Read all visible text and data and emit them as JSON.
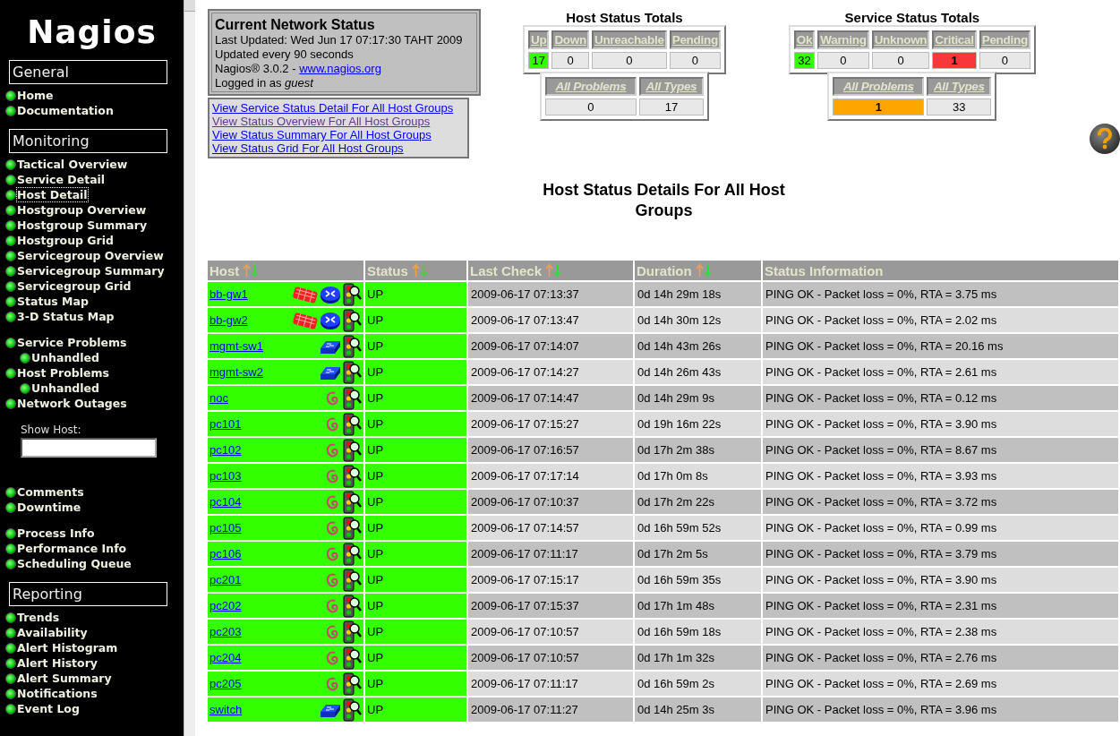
{
  "sidebar": {
    "logo": "Nagios",
    "sections": [
      {
        "title": "General",
        "groups": [
          {
            "kind": "links",
            "items": [
              {
                "label": "Home",
                "selected": false
              },
              {
                "label": "Documentation",
                "selected": false
              }
            ]
          }
        ]
      },
      {
        "title": "Monitoring",
        "groups": [
          {
            "kind": "links",
            "items": [
              {
                "label": "Tactical Overview",
                "selected": false
              },
              {
                "label": "Service Detail",
                "selected": false
              },
              {
                "label": "Host Detail",
                "selected": true
              },
              {
                "label": "Hostgroup Overview",
                "selected": false
              },
              {
                "label": "Hostgroup Summary",
                "selected": false
              },
              {
                "label": "Hostgroup Grid",
                "selected": false
              },
              {
                "label": "Servicegroup Overview",
                "selected": false
              },
              {
                "label": "Servicegroup Summary",
                "selected": false
              },
              {
                "label": "Servicegroup Grid",
                "selected": false
              },
              {
                "label": "Status Map",
                "selected": false
              },
              {
                "label": "3-D Status Map",
                "selected": false
              }
            ]
          },
          {
            "kind": "links",
            "items": [
              {
                "label": "Service Problems",
                "selected": false,
                "children": [
                  {
                    "label": "Unhandled",
                    "selected": false
                  }
                ]
              },
              {
                "label": "Host Problems",
                "selected": false,
                "children": [
                  {
                    "label": "Unhandled",
                    "selected": false
                  }
                ]
              },
              {
                "label": "Network Outages",
                "selected": false
              }
            ]
          },
          {
            "kind": "search",
            "label": "Show Host:"
          },
          {
            "kind": "links",
            "items": [
              {
                "label": "Comments",
                "selected": false
              },
              {
                "label": "Downtime",
                "selected": false
              }
            ]
          },
          {
            "kind": "links",
            "items": [
              {
                "label": "Process Info",
                "selected": false
              },
              {
                "label": "Performance Info",
                "selected": false
              },
              {
                "label": "Scheduling Queue",
                "selected": false
              }
            ]
          }
        ]
      },
      {
        "title": "Reporting",
        "groups": [
          {
            "kind": "links",
            "items": [
              {
                "label": "Trends",
                "selected": false
              },
              {
                "label": "Availability",
                "selected": false
              },
              {
                "label": "Alert Histogram",
                "selected": false
              },
              {
                "label": "Alert History",
                "selected": false
              },
              {
                "label": "Alert Summary",
                "selected": false
              },
              {
                "label": "Notifications",
                "selected": false
              },
              {
                "label": "Event Log",
                "selected": false
              }
            ]
          }
        ]
      }
    ]
  },
  "network_status": {
    "title": "Current Network Status",
    "last_updated": "Last Updated: Wed Jun 17 07:17:30 TAHT 2009",
    "interval": "Updated every 90 seconds",
    "version": "Nagios® 3.0.2 -",
    "website": "www.nagios.org",
    "login": "Logged in as *guest*"
  },
  "view_links": [
    {
      "label": "View Service Status Detail For All Host Groups",
      "visited": false
    },
    {
      "label": "View Status Overview For All Host Groups",
      "visited": true
    },
    {
      "label": "View Status Summary For All Host Groups",
      "visited": false
    },
    {
      "label": "View Status Grid For All Host Groups",
      "visited": false
    }
  ],
  "host_totals": {
    "title": "Host Status Totals",
    "cells": [
      {
        "label": "Up",
        "value": "17",
        "color": "#33ff00"
      },
      {
        "label": "Down",
        "value": "0"
      },
      {
        "label": "Unreachable",
        "value": "0"
      },
      {
        "label": "Pending",
        "value": "0"
      }
    ],
    "summary": [
      {
        "label": "All Problems",
        "value": "0"
      },
      {
        "label": "All Types",
        "value": "17"
      }
    ]
  },
  "service_totals": {
    "title": "Service Status Totals",
    "cells": [
      {
        "label": "Ok",
        "value": "32",
        "color": "#33ff00"
      },
      {
        "label": "Warning",
        "value": "0"
      },
      {
        "label": "Unknown",
        "value": "0"
      },
      {
        "label": "Critical",
        "value": "1",
        "color": "#f83838"
      },
      {
        "label": "Pending",
        "value": "0"
      }
    ],
    "summary": [
      {
        "label": "All Problems",
        "value": "1",
        "color": "#ffa500"
      },
      {
        "label": "All Types",
        "value": "33"
      }
    ]
  },
  "heading": "Host Status Details For All Host Groups",
  "table": {
    "columns": [
      {
        "label": "Host",
        "sortable": true
      },
      {
        "label": "Status",
        "sortable": true
      },
      {
        "label": "Last Check",
        "sortable": true
      },
      {
        "label": "Duration",
        "sortable": true
      },
      {
        "label": "Status Information",
        "sortable": false
      }
    ],
    "rows": [
      {
        "host": "bb-gw1",
        "kind": "router",
        "status": "UP",
        "last_check": "2009-06-17 07:13:37",
        "duration": "0d 14h 29m 18s",
        "info": "PING OK - Packet loss = 0%, RTA = 3.75 ms"
      },
      {
        "host": "bb-gw2",
        "kind": "router",
        "status": "UP",
        "last_check": "2009-06-17 07:13:47",
        "duration": "0d 14h 30m 12s",
        "info": "PING OK - Packet loss = 0%, RTA = 2.02 ms"
      },
      {
        "host": "mgmt-sw1",
        "kind": "switch",
        "status": "UP",
        "last_check": "2009-06-17 07:14:07",
        "duration": "0d 14h 43m 26s",
        "info": "PING OK - Packet loss = 0%, RTA = 20.16 ms"
      },
      {
        "host": "mgmt-sw2",
        "kind": "switch",
        "status": "UP",
        "last_check": "2009-06-17 07:14:27",
        "duration": "0d 14h 26m 43s",
        "info": "PING OK - Packet loss = 0%, RTA = 2.61 ms"
      },
      {
        "host": "noc",
        "kind": "debian",
        "status": "UP",
        "last_check": "2009-06-17 07:14:47",
        "duration": "0d 14h 29m 9s",
        "info": "PING OK - Packet loss = 0%, RTA = 0.12 ms"
      },
      {
        "host": "pc101",
        "kind": "debian",
        "status": "UP",
        "last_check": "2009-06-17 07:15:27",
        "duration": "0d 19h 16m 22s",
        "info": "PING OK - Packet loss = 0%, RTA = 3.90 ms"
      },
      {
        "host": "pc102",
        "kind": "debian",
        "status": "UP",
        "last_check": "2009-06-17 07:16:57",
        "duration": "0d 17h 2m 38s",
        "info": "PING OK - Packet loss = 0%, RTA = 8.67 ms"
      },
      {
        "host": "pc103",
        "kind": "debian",
        "status": "UP",
        "last_check": "2009-06-17 07:17:14",
        "duration": "0d 17h 0m 8s",
        "info": "PING OK - Packet loss = 0%, RTA = 3.93 ms"
      },
      {
        "host": "pc104",
        "kind": "debian",
        "status": "UP",
        "last_check": "2009-06-17 07:10:37",
        "duration": "0d 17h 2m 22s",
        "info": "PING OK - Packet loss = 0%, RTA = 3.72 ms"
      },
      {
        "host": "pc105",
        "kind": "debian",
        "status": "UP",
        "last_check": "2009-06-17 07:14:57",
        "duration": "0d 16h 59m 52s",
        "info": "PING OK - Packet loss = 0%, RTA = 0.99 ms"
      },
      {
        "host": "pc106",
        "kind": "debian",
        "status": "UP",
        "last_check": "2009-06-17 07:11:17",
        "duration": "0d 17h 2m 5s",
        "info": "PING OK - Packet loss = 0%, RTA = 3.79 ms"
      },
      {
        "host": "pc201",
        "kind": "debian",
        "status": "UP",
        "last_check": "2009-06-17 07:15:17",
        "duration": "0d 16h 59m 35s",
        "info": "PING OK - Packet loss = 0%, RTA = 3.90 ms"
      },
      {
        "host": "pc202",
        "kind": "debian",
        "status": "UP",
        "last_check": "2009-06-17 07:15:37",
        "duration": "0d 17h 1m 48s",
        "info": "PING OK - Packet loss = 0%, RTA = 2.31 ms"
      },
      {
        "host": "pc203",
        "kind": "debian",
        "status": "UP",
        "last_check": "2009-06-17 07:10:57",
        "duration": "0d 16h 59m 18s",
        "info": "PING OK - Packet loss = 0%, RTA = 2.38 ms"
      },
      {
        "host": "pc204",
        "kind": "debian",
        "status": "UP",
        "last_check": "2009-06-17 07:10:57",
        "duration": "0d 17h 1m 32s",
        "info": "PING OK - Packet loss = 0%, RTA = 2.76 ms"
      },
      {
        "host": "pc205",
        "kind": "debian",
        "status": "UP",
        "last_check": "2009-06-17 07:11:17",
        "duration": "0d 16h 59m 2s",
        "info": "PING OK - Packet loss = 0%, RTA = 2.69 ms"
      },
      {
        "host": "switch",
        "kind": "switch",
        "status": "UP",
        "last_check": "2009-06-17 07:11:27",
        "duration": "0d 14h 25m 3s",
        "info": "PING OK - Packet loss = 0%, RTA = 3.96 ms"
      }
    ]
  }
}
